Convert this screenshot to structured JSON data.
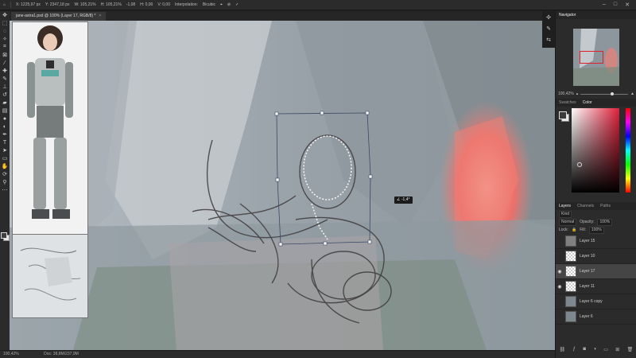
{
  "options_bar": {
    "x": "X: 1225,97 px",
    "y": "Y: 2347,18 px",
    "w": "W: 105,21%",
    "h": "H: 105,21%",
    "angle": "-1,08",
    "hskew": "H: 0,00",
    "vskew": "V: 0,00",
    "interp_label": "Interpolation:",
    "interp_value": "Bicubic"
  },
  "document_tab": {
    "title": "jane-astra1.psd @ 100% (Layer 17, RGB/8) *"
  },
  "canvas": {
    "rotation_readout": "∠ -1,4°"
  },
  "status": {
    "zoom": "100,42%",
    "doc": "Doc: 38,8M/237,9M"
  },
  "navigator": {
    "title": "Navigator",
    "zoom": "100,42%"
  },
  "color_panel": {
    "tab_swatches": "Swatches",
    "tab_color": "Color"
  },
  "layers_panel": {
    "tabs": [
      "Layers",
      "Channels",
      "Paths"
    ],
    "kind_label": "Kind",
    "blend_mode": "Normal",
    "opacity_label": "Opacity:",
    "opacity_value": "100%",
    "lock_label": "Lock:",
    "fill_label": "Fill:",
    "fill_value": "100%",
    "layers": [
      {
        "name": "Layer 15",
        "visible": false,
        "thumb": "gray"
      },
      {
        "name": "Layer 10",
        "visible": false,
        "thumb": "check"
      },
      {
        "name": "Layer 17",
        "visible": true,
        "thumb": "check",
        "selected": true
      },
      {
        "name": "Layer 11",
        "visible": true,
        "thumb": "check"
      },
      {
        "name": "Layer 6 copy",
        "visible": false,
        "thumb": "img"
      },
      {
        "name": "Layer 6",
        "visible": false,
        "thumb": "img"
      }
    ]
  },
  "colors": {
    "accent_red": "#e0203a",
    "canvas_bg": "#9ba3ab",
    "glow": "#ef7f76"
  },
  "icons": [
    "move-icon",
    "marquee-icon",
    "lasso-icon",
    "magic-wand-icon",
    "crop-icon",
    "eyedropper-icon",
    "brush-icon",
    "eraser-icon",
    "pen-icon",
    "type-icon",
    "hand-icon",
    "zoom-icon",
    "commit-check-icon",
    "cancel-icon",
    "eye-icon"
  ]
}
